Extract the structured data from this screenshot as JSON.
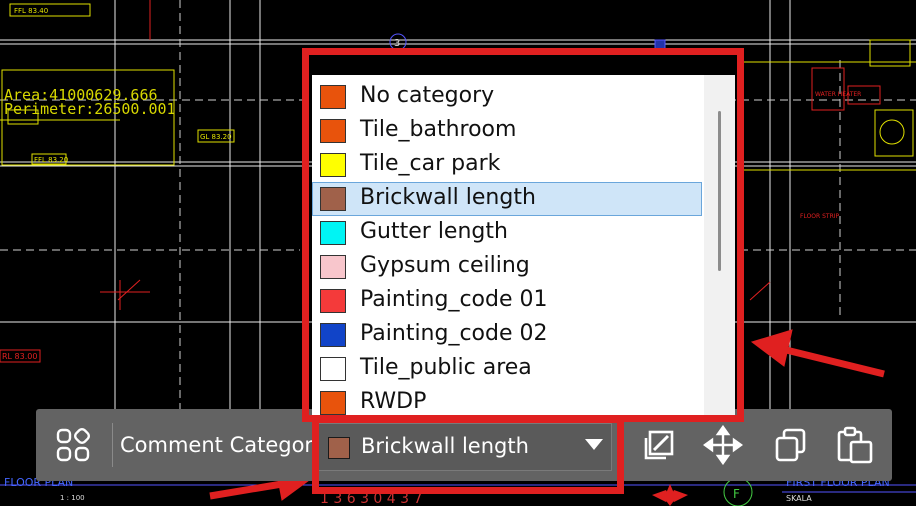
{
  "drawing": {
    "area_text": "Area:41000629.666",
    "perimeter_text": "Perimeter:26500.001",
    "axis_marker": "3",
    "ffl_top_left": "FFL 83.40",
    "ffl_mid": "FFL 83.20",
    "gl_label": "GL 83.20",
    "rl_label": "RL 83.00",
    "floor_plan_left": "FLOOR PLAN",
    "scale_left": "1 : 100",
    "floor_plan_right": "FIRST FLOOR PLAN",
    "scale_right": "SKALA",
    "grid_f": "F",
    "water_heater": "WATER HEATER",
    "floor_strip": "FLOOR STRIP",
    "partial_dims": "1 3 6 3 0  4 3 7"
  },
  "toolbar": {
    "grid_icon": "grid-icon",
    "category_label": "Comment Category",
    "selected_category": "Brickwall length",
    "selected_color": "#a0614a",
    "actions": [
      "edit-icon",
      "move-icon",
      "copy-icon",
      "paste-icon"
    ]
  },
  "categories": [
    {
      "label": "No category",
      "color": "#e8530c"
    },
    {
      "label": "Tile_bathroom",
      "color": "#e8530c"
    },
    {
      "label": "Tile_car park",
      "color": "#ffff00"
    },
    {
      "label": "Brickwall length",
      "color": "#a0614a",
      "selected": true
    },
    {
      "label": "Gutter length",
      "color": "#00f4f4"
    },
    {
      "label": "Gypsum ceiling",
      "color": "#f8c6cc"
    },
    {
      "label": "Painting_code 01",
      "color": "#f43a3a"
    },
    {
      "label": "Painting_code 02",
      "color": "#1144c8"
    },
    {
      "label": "Tile_public area",
      "color": "#ffffff"
    },
    {
      "label": "RWDP",
      "color": "#e8530c"
    }
  ],
  "annotation_color": "#e02020"
}
